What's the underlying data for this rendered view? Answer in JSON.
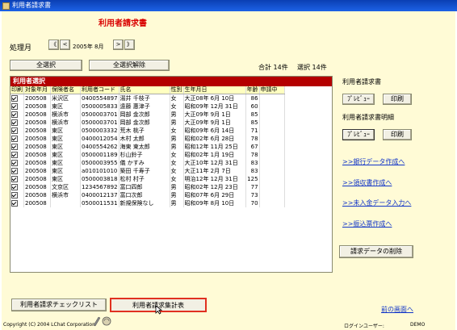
{
  "window": {
    "title": "利用者請求書"
  },
  "header": {
    "title": "利用者請求書"
  },
  "period": {
    "label": "処理月",
    "value": "2005年 8月",
    "first": "《",
    "prev": "<",
    "next": ">",
    "last": "》"
  },
  "toolbar": {
    "select_all": "全選択",
    "deselect_all": "全選択解除"
  },
  "summary": {
    "total": "合計 14件",
    "selected": "選択 14件"
  },
  "grid": {
    "title": "利用者選択",
    "columns": [
      "印刷",
      "対象年月",
      "保険者名",
      "利用者コード",
      "氏名",
      "性別",
      "生年月日",
      "年齢",
      "申請中"
    ],
    "rows": [
      [
        "200508",
        "米沢区",
        "0400554897",
        "湯井 千枝子",
        "女",
        "大正08年 6月 10日",
        "86",
        ""
      ],
      [
        "200508",
        "東区",
        "0500005833",
        "遠藤 惠津子",
        "女",
        "昭和09年 12月 31日",
        "60",
        ""
      ],
      [
        "200508",
        "横浜市",
        "0500003701",
        "岡部 金次郎",
        "男",
        "大正09年 9月 1日",
        "85",
        ""
      ],
      [
        "200508",
        "横浜市",
        "0500003701",
        "岡部 金次郎",
        "男",
        "大正09年 9月 1日",
        "85",
        ""
      ],
      [
        "200508",
        "東区",
        "0500003332",
        "荒木 桃子",
        "女",
        "昭和09年 6月 14日",
        "71",
        ""
      ],
      [
        "200508",
        "東区",
        "0400012054",
        "木村 太郎",
        "男",
        "昭和02年 6月 28日",
        "78",
        ""
      ],
      [
        "200508",
        "東区",
        "0400554262",
        "海東 東太郎",
        "男",
        "昭和12年 11月 25日",
        "67",
        ""
      ],
      [
        "200508",
        "東区",
        "0500001189",
        "杉山鈴子",
        "女",
        "昭和02年 1月 19日",
        "78",
        ""
      ],
      [
        "200508",
        "東区",
        "0500003955",
        "儀 かすみ",
        "女",
        "大正10年 12月 31日",
        "83",
        ""
      ],
      [
        "200508",
        "東区",
        "a010101010",
        "築田 千寿子",
        "女",
        "大正11年 2月 7日",
        "83",
        ""
      ],
      [
        "200508",
        "東区",
        "0500003818",
        "松村 村子",
        "女",
        "明治12年 12月 31日",
        "125",
        ""
      ],
      [
        "200508",
        "文京区",
        "1234567892",
        "富口四郎",
        "男",
        "昭和02年 12月 23日",
        "77",
        ""
      ],
      [
        "200508",
        "横浜市",
        "0400012137",
        "富口次郎",
        "男",
        "昭和07年 6月 29日",
        "73",
        ""
      ],
      [
        "200508",
        "",
        "0500011531",
        "新規保険なし",
        "男",
        "昭和09年 8月 10日",
        "70",
        ""
      ]
    ]
  },
  "right": {
    "invoice_label": "利用者請求書",
    "preview": "ﾌﾟﾚﾋﾞｭｰ",
    "print": "印刷",
    "detail_label": "利用者請求書明細",
    "links": [
      ">>銀行データ作成へ",
      ">>領収書作成へ",
      ">>未入金データ入力へ",
      ">>振込票作成へ"
    ],
    "delete_button": "請求データの削除"
  },
  "bottom": {
    "checklist_button": "利用者請求チェックリスト",
    "summary_button": "利用者請求集計表",
    "back_link": "前の画面へ"
  },
  "footer": {
    "copyright": "Copyright (C) 2004 LChat Corporation",
    "login": "ログインユーザー:",
    "user": "DEMO"
  }
}
